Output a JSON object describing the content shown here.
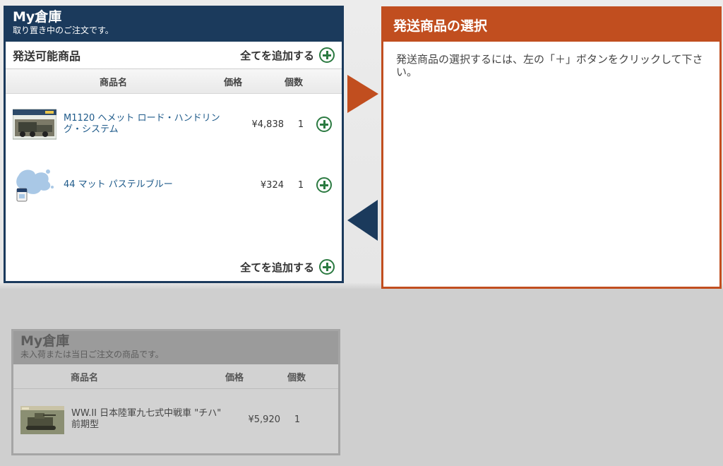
{
  "available": {
    "title": "My倉庫",
    "subtitle": "取り置き中のご注文です。",
    "section_title": "発送可能商品",
    "add_all_label": "全てを追加する",
    "columns": {
      "name": "商品名",
      "price": "価格",
      "qty": "個数"
    },
    "items": [
      {
        "name": "M1120 ヘメット ロード・ハンドリング・システム",
        "price": "¥4,838",
        "qty": "1"
      },
      {
        "name": "44 マット パステルブルー",
        "price": "¥324",
        "qty": "1"
      }
    ]
  },
  "shipping": {
    "title": "発送商品の選択",
    "message": "発送商品の選択するには、左の「＋」ボタンをクリックして下さい。"
  },
  "unavailable": {
    "title": "My倉庫",
    "subtitle": "未入荷または当日ご注文の商品です。",
    "columns": {
      "name": "商品名",
      "price": "価格",
      "qty": "個数"
    },
    "items": [
      {
        "name": "WW.II 日本陸軍九七式中戦車 \"チハ\" 前期型",
        "price": "¥5,920",
        "qty": "1"
      }
    ]
  },
  "colors": {
    "navy": "#1b3a5c",
    "orange": "#c14e1f",
    "green": "#2b7a41",
    "link": "#1e5a8a"
  },
  "icons": [
    "plus-circle-icon",
    "arrow-right-icon",
    "arrow-left-icon"
  ]
}
